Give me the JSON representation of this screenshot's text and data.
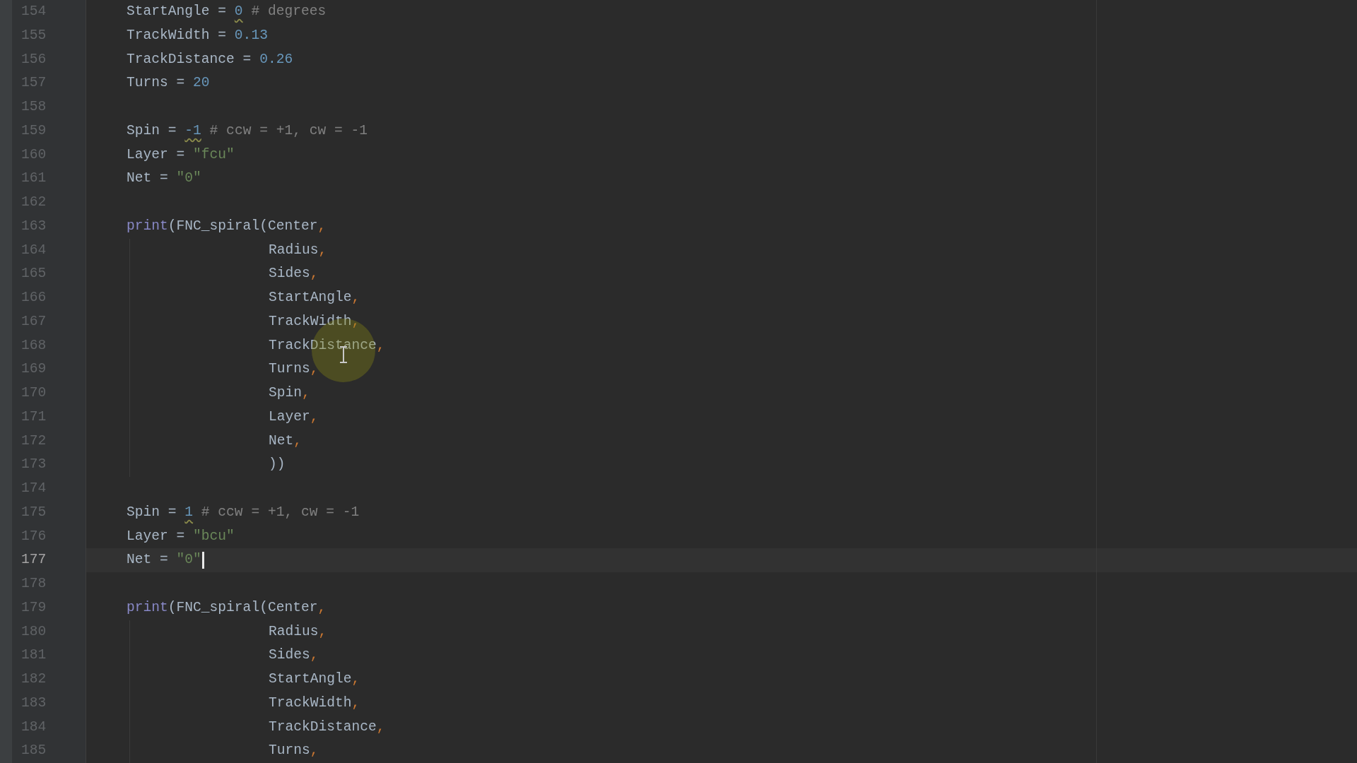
{
  "editor": {
    "lines": [
      {
        "number": "154",
        "kind": "code",
        "current": false,
        "caret": false,
        "tokens": [
          {
            "kind": "plain",
            "text": "StartAngle = "
          },
          {
            "kind": "number",
            "text": "0",
            "warning": true
          },
          {
            "kind": "comment",
            "text": " # degrees"
          }
        ]
      },
      {
        "number": "155",
        "kind": "code",
        "current": false,
        "caret": false,
        "tokens": [
          {
            "kind": "plain",
            "text": "TrackWidth = "
          },
          {
            "kind": "number",
            "text": "0.13"
          }
        ]
      },
      {
        "number": "156",
        "kind": "code",
        "current": false,
        "caret": false,
        "tokens": [
          {
            "kind": "plain",
            "text": "TrackDistance = "
          },
          {
            "kind": "number",
            "text": "0.26"
          }
        ]
      },
      {
        "number": "157",
        "kind": "code",
        "current": false,
        "caret": false,
        "tokens": [
          {
            "kind": "plain",
            "text": "Turns = "
          },
          {
            "kind": "number",
            "text": "20"
          }
        ]
      },
      {
        "number": "158",
        "kind": "code",
        "current": false,
        "caret": false
      },
      {
        "number": "159",
        "kind": "code",
        "current": false,
        "caret": false,
        "tokens": [
          {
            "kind": "plain",
            "text": "Spin = "
          },
          {
            "kind": "number",
            "text": "-1",
            "warning": true
          },
          {
            "kind": "comment",
            "text": " # ccw = +1, cw = -1"
          }
        ]
      },
      {
        "number": "160",
        "kind": "code",
        "current": false,
        "caret": false,
        "tokens": [
          {
            "kind": "plain",
            "text": "Layer = "
          },
          {
            "kind": "string",
            "text": "\"fcu\""
          }
        ]
      },
      {
        "number": "161",
        "kind": "code",
        "current": false,
        "caret": false,
        "tokens": [
          {
            "kind": "plain",
            "text": "Net = "
          },
          {
            "kind": "string",
            "text": "\"0\""
          }
        ]
      },
      {
        "number": "162",
        "kind": "code",
        "current": false,
        "caret": false
      },
      {
        "number": "163",
        "kind": "code",
        "current": false,
        "caret": false,
        "tokens": [
          {
            "kind": "builtin",
            "text": "print"
          },
          {
            "kind": "plain",
            "text": "(FNC_spiral(Center"
          },
          {
            "kind": "punct",
            "text": ","
          }
        ]
      },
      {
        "number": "164",
        "kind": "continuation",
        "current": false,
        "caret": false,
        "tokens": [
          {
            "kind": "plain",
            "text": "Radius"
          },
          {
            "kind": "punct",
            "text": ","
          }
        ]
      },
      {
        "number": "165",
        "kind": "continuation",
        "current": false,
        "caret": false,
        "tokens": [
          {
            "kind": "plain",
            "text": "Sides"
          },
          {
            "kind": "punct",
            "text": ","
          }
        ]
      },
      {
        "number": "166",
        "kind": "continuation",
        "current": false,
        "caret": false,
        "tokens": [
          {
            "kind": "plain",
            "text": "StartAngle"
          },
          {
            "kind": "punct",
            "text": ","
          }
        ]
      },
      {
        "number": "167",
        "kind": "continuation",
        "current": false,
        "caret": false,
        "tokens": [
          {
            "kind": "plain",
            "text": "TrackWidth"
          },
          {
            "kind": "punct",
            "text": ","
          }
        ]
      },
      {
        "number": "168",
        "kind": "continuation",
        "current": false,
        "caret": false,
        "tokens": [
          {
            "kind": "plain",
            "text": "TrackDistance"
          },
          {
            "kind": "punct",
            "text": ","
          }
        ]
      },
      {
        "number": "169",
        "kind": "continuation",
        "current": false,
        "caret": false,
        "tokens": [
          {
            "kind": "plain",
            "text": "Turns"
          },
          {
            "kind": "punct",
            "text": ","
          }
        ]
      },
      {
        "number": "170",
        "kind": "continuation",
        "current": false,
        "caret": false,
        "tokens": [
          {
            "kind": "plain",
            "text": "Spin"
          },
          {
            "kind": "punct",
            "text": ","
          }
        ]
      },
      {
        "number": "171",
        "kind": "continuation",
        "current": false,
        "caret": false,
        "tokens": [
          {
            "kind": "plain",
            "text": "Layer"
          },
          {
            "kind": "punct",
            "text": ","
          }
        ]
      },
      {
        "number": "172",
        "kind": "continuation",
        "current": false,
        "caret": false,
        "tokens": [
          {
            "kind": "plain",
            "text": "Net"
          },
          {
            "kind": "punct",
            "text": ","
          }
        ]
      },
      {
        "number": "173",
        "kind": "continuation",
        "current": false,
        "caret": false,
        "tokens": [
          {
            "kind": "plain",
            "text": "))"
          }
        ]
      },
      {
        "number": "174",
        "kind": "code",
        "current": false,
        "caret": false
      },
      {
        "number": "175",
        "kind": "code",
        "current": false,
        "caret": false,
        "tokens": [
          {
            "kind": "plain",
            "text": "Spin = "
          },
          {
            "kind": "number",
            "text": "1",
            "warning": true
          },
          {
            "kind": "comment",
            "text": " # ccw = +1, cw = -1"
          }
        ]
      },
      {
        "number": "176",
        "kind": "code",
        "current": false,
        "caret": false,
        "tokens": [
          {
            "kind": "plain",
            "text": "Layer = "
          },
          {
            "kind": "string",
            "text": "\"bcu\""
          }
        ]
      },
      {
        "number": "177",
        "kind": "code",
        "current": true,
        "caret": true,
        "tokens": [
          {
            "kind": "plain",
            "text": "Net = "
          },
          {
            "kind": "string",
            "text": "\"0\""
          }
        ]
      },
      {
        "number": "178",
        "kind": "code",
        "current": false,
        "caret": false
      },
      {
        "number": "179",
        "kind": "code",
        "current": false,
        "caret": false,
        "tokens": [
          {
            "kind": "builtin",
            "text": "print"
          },
          {
            "kind": "plain",
            "text": "(FNC_spiral(Center"
          },
          {
            "kind": "punct",
            "text": ","
          }
        ]
      },
      {
        "number": "180",
        "kind": "continuation",
        "current": false,
        "caret": false,
        "tokens": [
          {
            "kind": "plain",
            "text": "Radius"
          },
          {
            "kind": "punct",
            "text": ","
          }
        ]
      },
      {
        "number": "181",
        "kind": "continuation",
        "current": false,
        "caret": false,
        "tokens": [
          {
            "kind": "plain",
            "text": "Sides"
          },
          {
            "kind": "punct",
            "text": ","
          }
        ]
      },
      {
        "number": "182",
        "kind": "continuation",
        "current": false,
        "caret": false,
        "tokens": [
          {
            "kind": "plain",
            "text": "StartAngle"
          },
          {
            "kind": "punct",
            "text": ","
          }
        ]
      },
      {
        "number": "183",
        "kind": "continuation",
        "current": false,
        "caret": false,
        "tokens": [
          {
            "kind": "plain",
            "text": "TrackWidth"
          },
          {
            "kind": "punct",
            "text": ","
          }
        ]
      },
      {
        "number": "184",
        "kind": "continuation",
        "current": false,
        "caret": false,
        "tokens": [
          {
            "kind": "plain",
            "text": "TrackDistance"
          },
          {
            "kind": "punct",
            "text": ","
          }
        ]
      },
      {
        "number": "185",
        "kind": "continuation",
        "current": false,
        "caret": false,
        "tokens": [
          {
            "kind": "plain",
            "text": "Turns"
          },
          {
            "kind": "punct",
            "text": ","
          }
        ]
      }
    ]
  }
}
